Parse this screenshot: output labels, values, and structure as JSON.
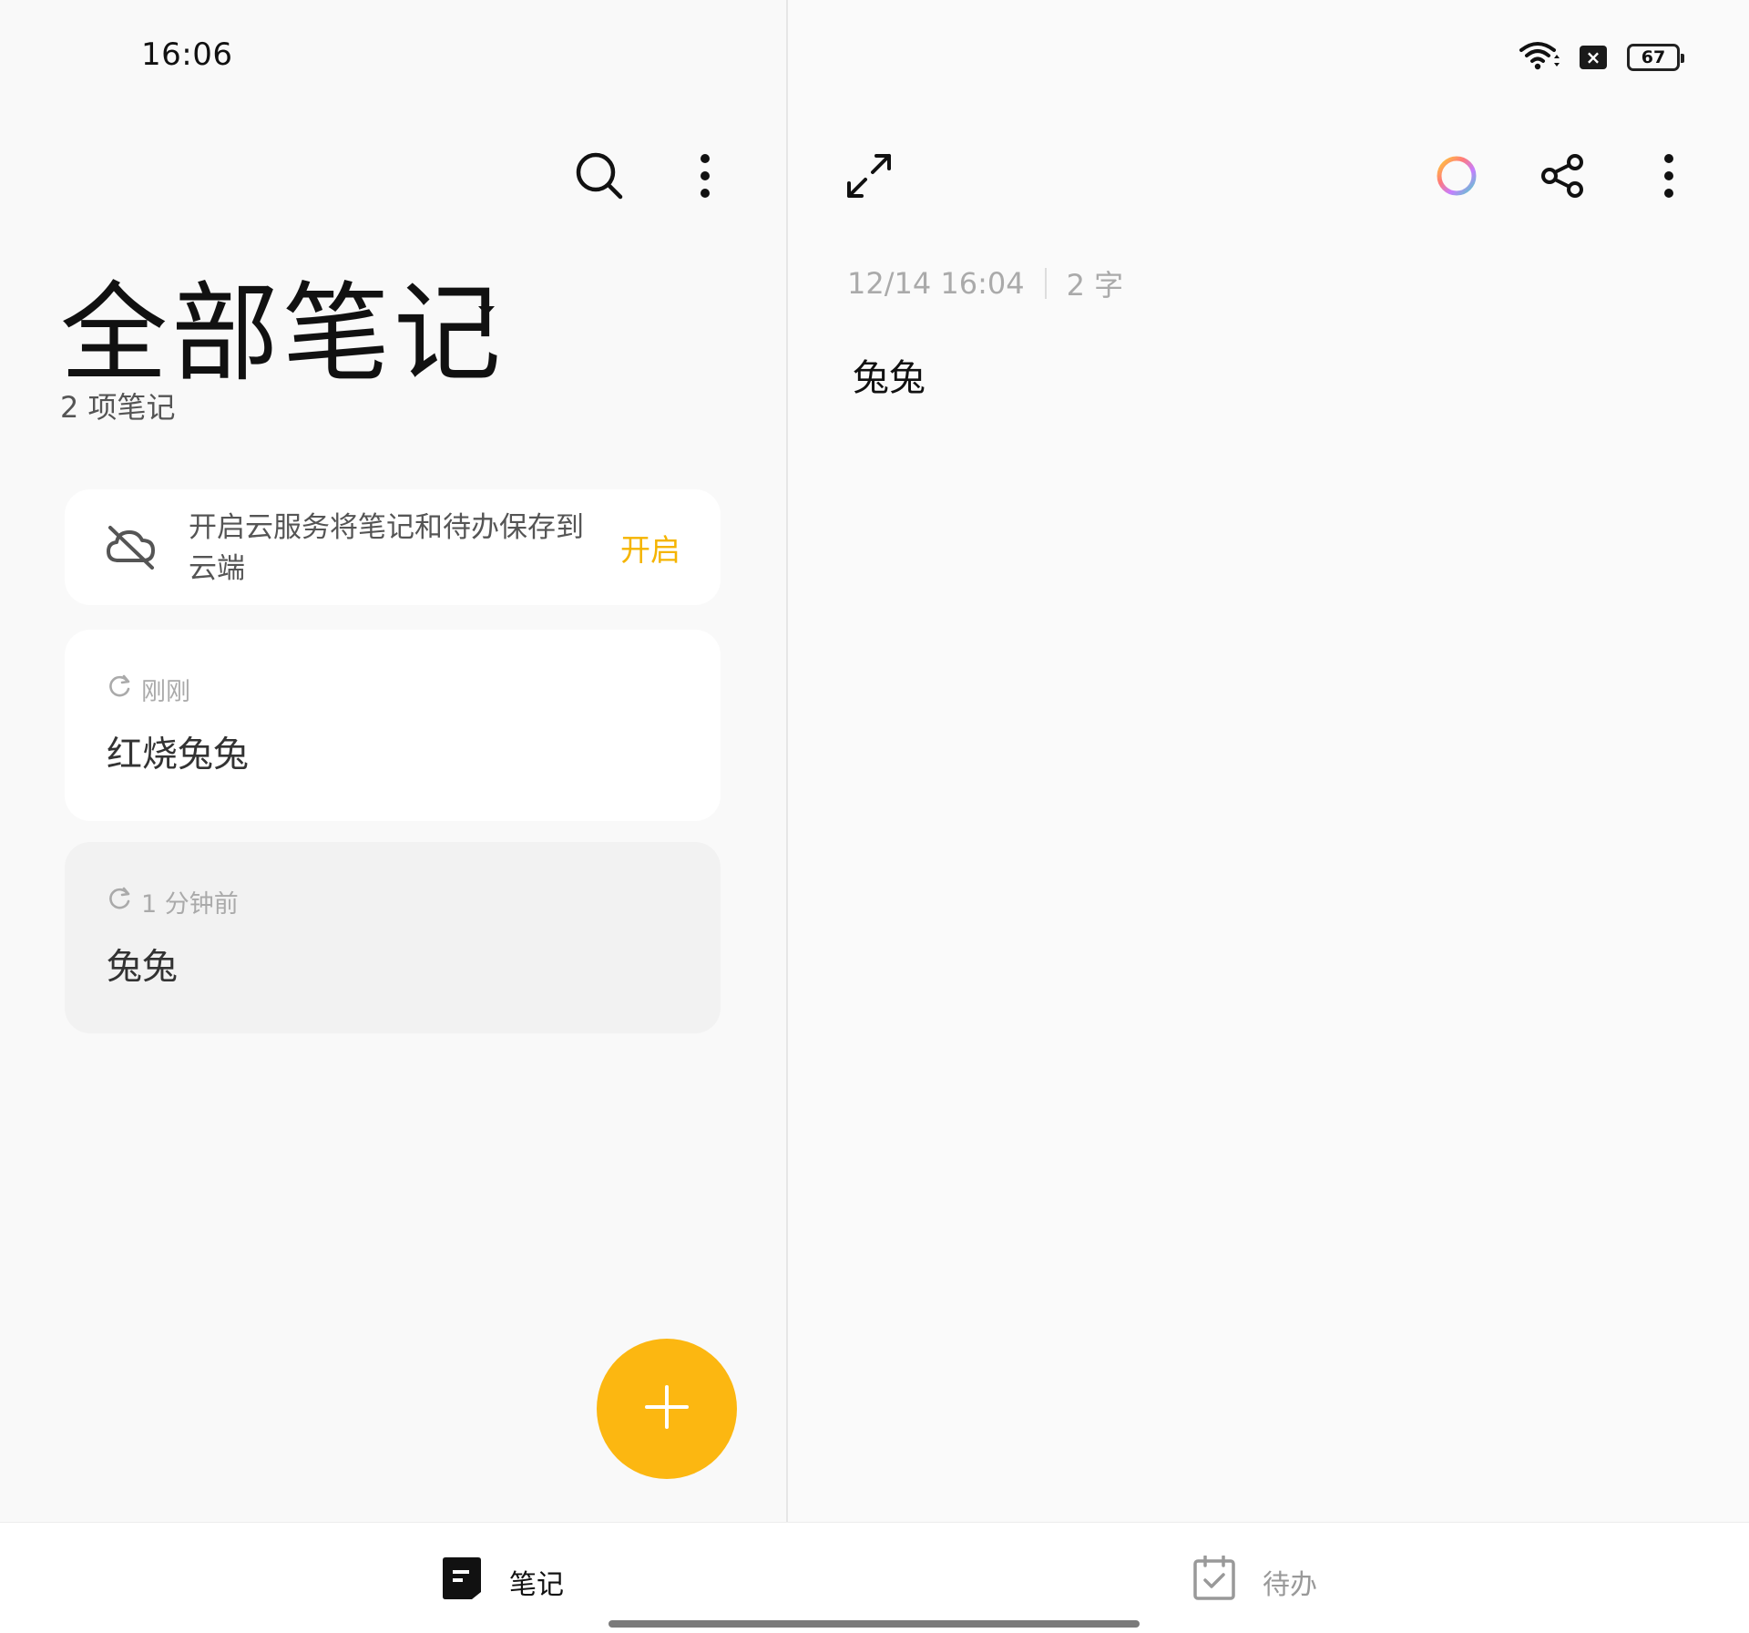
{
  "status_bar": {
    "time": "16:06",
    "battery": "67",
    "sim_badge": "×"
  },
  "left": {
    "title": "全部笔记",
    "count": "2 项笔记",
    "cloud_banner": {
      "message": "开启云服务将笔记和待办保存到云端",
      "action": "开启"
    },
    "notes": [
      {
        "time": "刚刚",
        "title": "红烧兔兔"
      },
      {
        "time": "1 分钟前",
        "title": "兔兔"
      }
    ]
  },
  "right": {
    "date": "12/14 16:04",
    "word_count": "2 字",
    "body": "兔兔"
  },
  "bottom_nav": {
    "notes_label": "笔记",
    "todo_label": "待办"
  },
  "colors": {
    "accent": "#fcb711",
    "accent_text": "#f5b400",
    "selected_card": "#f2f2f2"
  },
  "icons": {
    "search": "search-icon",
    "more": "more-vertical-icon",
    "expand": "expand-icon",
    "color": "color-ring-icon",
    "share": "share-icon",
    "cloud_off": "cloud-off-icon",
    "sync": "sync-icon",
    "add": "plus-icon",
    "notes": "note-icon",
    "todo": "todo-check-icon"
  }
}
